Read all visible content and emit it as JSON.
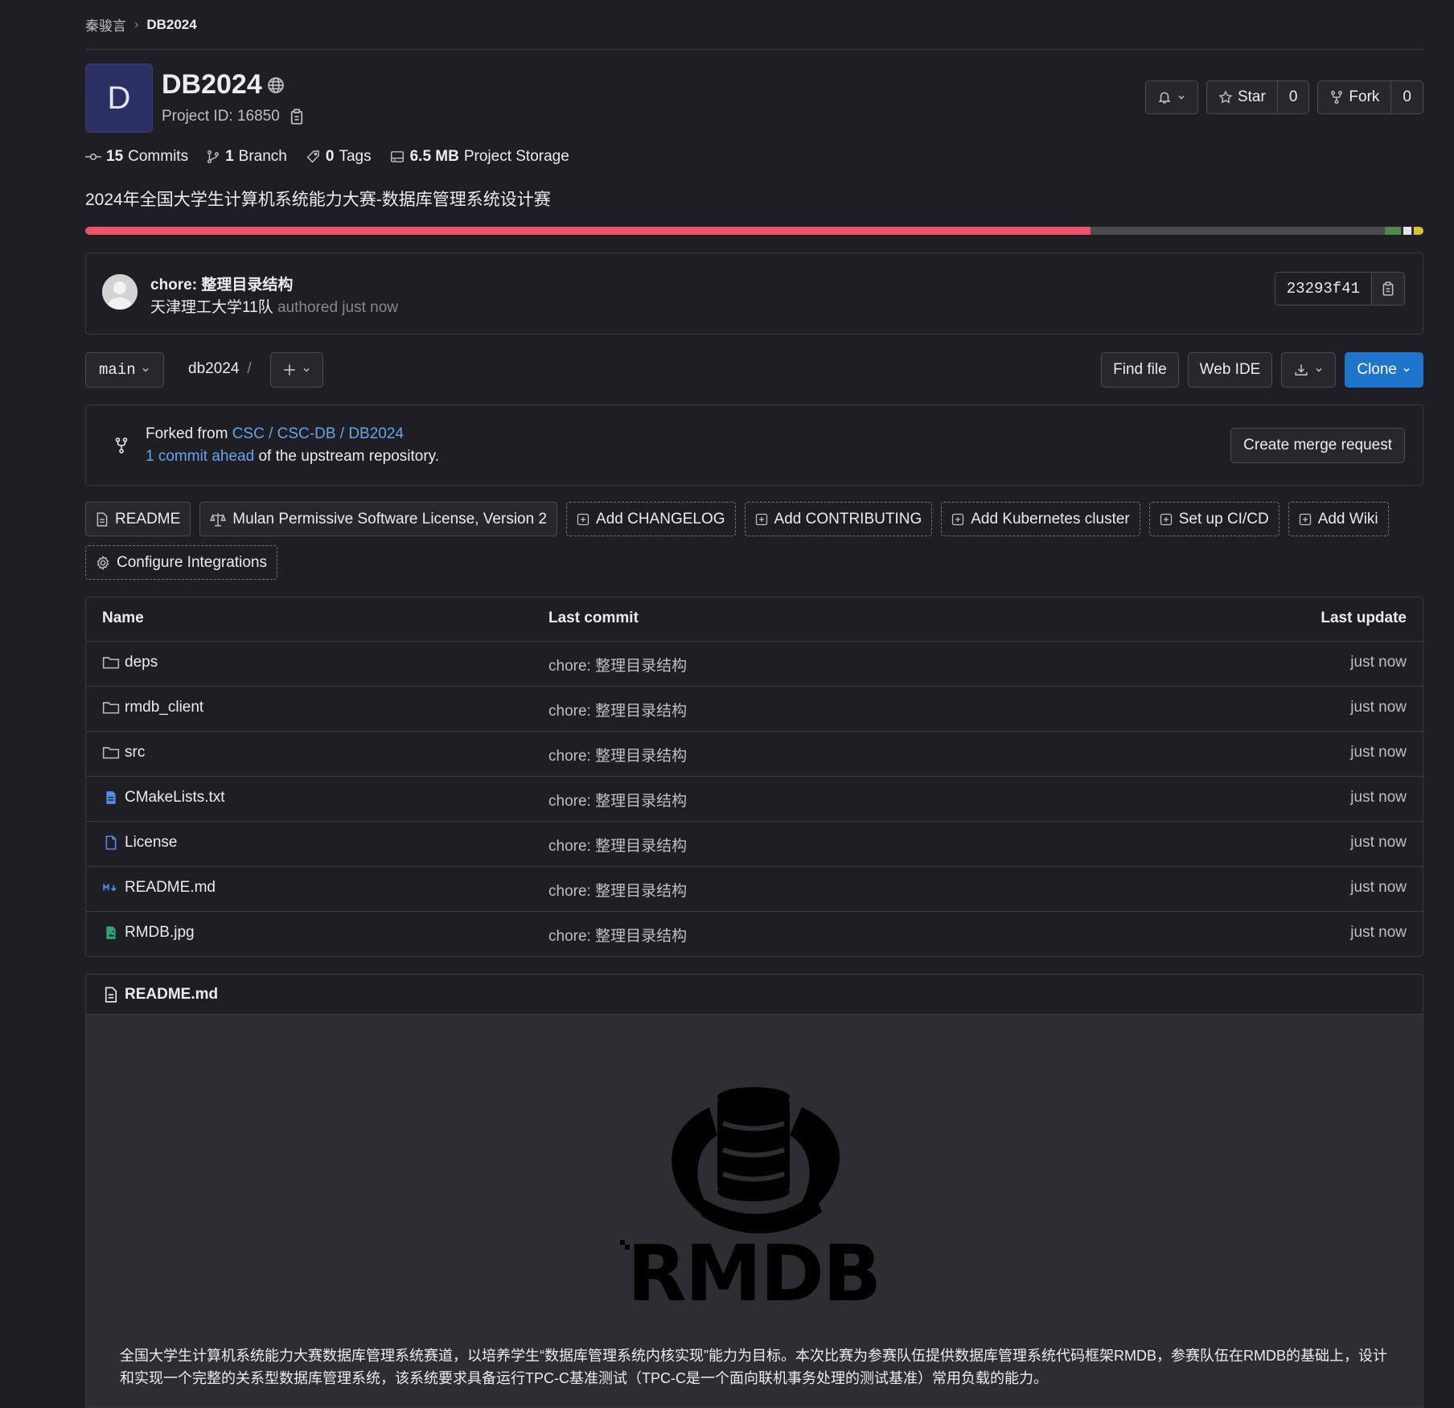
{
  "breadcrumb": {
    "owner": "秦骏言",
    "project": "DB2024"
  },
  "project": {
    "avatar_letter": "D",
    "name": "DB2024",
    "id_text": "Project ID: 16850",
    "description": "2024年全国大学生计算机系统能力大赛-数据库管理系统设计赛"
  },
  "header_buttons": {
    "star_label": "Star",
    "star_count": "0",
    "fork_label": "Fork",
    "fork_count": "0"
  },
  "stats": {
    "commits_num": "15",
    "commits_label": "Commits",
    "branch_num": "1",
    "branch_label": "Branch",
    "tags_num": "0",
    "tags_label": "Tags",
    "storage_num": "6.5 MB",
    "storage_label": "Project Storage"
  },
  "language_bar": [
    {
      "color": "#e9546b",
      "fraction": 0.751
    },
    {
      "color": "#4b4a4e",
      "fraction": 0.22
    },
    {
      "color": "#4f8a4d",
      "fraction": 0.012
    },
    {
      "color": "#2e2d33",
      "fraction": 0.002
    },
    {
      "color": "#e5e5e5",
      "fraction": 0.006
    },
    {
      "color": "#2e2d33",
      "fraction": 0.002
    },
    {
      "color": "#d6c32f",
      "fraction": 0.007
    }
  ],
  "last_commit": {
    "title": "chore: 整理目录结构",
    "author": "天津理工大学11队",
    "meta": "authored just now",
    "sha": "23293f41"
  },
  "toolbar": {
    "branch": "main",
    "path": "db2024",
    "path_sep": "/",
    "find_file": "Find file",
    "web_ide": "Web IDE",
    "clone": "Clone"
  },
  "fork_info": {
    "prefix": "Forked from ",
    "source": "CSC / CSC-DB / DB2024",
    "ahead_link": "1 commit ahead",
    "ahead_rest": " of the upstream repository.",
    "mr_button": "Create merge request"
  },
  "shortcuts": {
    "readme": "README",
    "license": "Mulan Permissive Software License, Version 2",
    "changelog": "Add CHANGELOG",
    "contributing": "Add CONTRIBUTING",
    "kubernetes": "Add Kubernetes cluster",
    "cicd": "Set up CI/CD",
    "wiki": "Add Wiki",
    "integrations": "Configure Integrations"
  },
  "table": {
    "headers": {
      "name": "Name",
      "commit": "Last commit",
      "update": "Last update"
    },
    "rows": [
      {
        "name": "deps",
        "icon": "folder-icon",
        "commit": "chore: 整理目录结构",
        "updated": "just now"
      },
      {
        "name": "rmdb_client",
        "icon": "folder-icon",
        "commit": "chore: 整理目录结构",
        "updated": "just now"
      },
      {
        "name": "src",
        "icon": "folder-icon",
        "commit": "chore: 整理目录结构",
        "updated": "just now"
      },
      {
        "name": "CMakeLists.txt",
        "icon": "text-file-icon",
        "commit": "chore: 整理目录结构",
        "updated": "just now"
      },
      {
        "name": "License",
        "icon": "file-icon",
        "commit": "chore: 整理目录结构",
        "updated": "just now"
      },
      {
        "name": "README.md",
        "icon": "markdown-icon",
        "commit": "chore: 整理目录结构",
        "updated": "just now"
      },
      {
        "name": "RMDB.jpg",
        "icon": "image-file-icon",
        "commit": "chore: 整理目录结构",
        "updated": "just now"
      }
    ]
  },
  "readme": {
    "filename": "README.md",
    "logo_text": "RMDB",
    "paragraph": "全国大学生计算机系统能力大赛数据库管理系统赛道，以培养学生“数据库管理系统内核实现”能力为目标。本次比赛为参赛队伍提供数据库管理系统代码框架RMDB，参赛队伍在RMDB的基础上，设计和实现一个完整的关系型数据库管理系统，该系统要求具备运行TPC-C基准测试（TPC-C是一个面向联机事务处理的测试基准）常用负载的能力。"
  }
}
